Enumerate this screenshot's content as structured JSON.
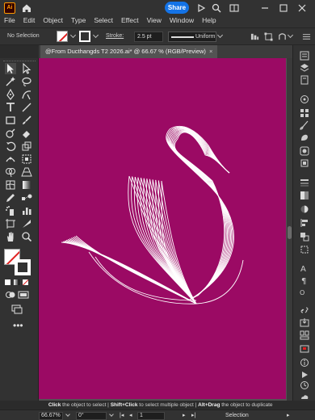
{
  "app": {
    "logo_text": "Ai"
  },
  "menu": [
    "File",
    "Edit",
    "Object",
    "Type",
    "Select",
    "Effect",
    "View",
    "Window",
    "Help"
  ],
  "share_label": "Share",
  "control": {
    "selection_status": "No Selection",
    "stroke_label": "Stroke:",
    "stroke_weight": "2.5 pt",
    "profile": "Uniform"
  },
  "document": {
    "tab_title": "@From Ducthangds T2 2026.ai* @ 66.67 % (RGB/Preview)",
    "close_glyph": "×"
  },
  "canvas": {
    "artboard_color": "#9b0a64",
    "art_stroke_color": "#ffffff"
  },
  "hint": {
    "k1": "Click",
    "t1": "the object to select",
    "k2": "Shift+Click",
    "t2": "to select multiple object",
    "k3": "Alt+Drag",
    "t3": "the object to duplicate"
  },
  "status": {
    "zoom": "66.67%",
    "rotation": "0°",
    "artboard_number": "1",
    "tool_name": "Selection"
  },
  "colors": {
    "accent": "#1473e6",
    "logo": "#ff9a00"
  },
  "icons": {
    "left_tools": [
      "selection-tool-icon",
      "direct-selection-tool-icon",
      "magic-wand-icon",
      "lasso-icon",
      "pen-tool-icon",
      "curvature-tool-icon",
      "type-tool-icon",
      "line-tool-icon",
      "rectangle-tool-icon",
      "paintbrush-icon",
      "shaper-tool-icon",
      "eraser-icon",
      "rotate-tool-icon",
      "scale-tool-icon",
      "width-tool-icon",
      "free-transform-icon",
      "shape-builder-icon",
      "perspective-grid-icon",
      "mesh-tool-icon",
      "gradient-tool-icon",
      "eyedropper-icon",
      "blend-tool-icon",
      "symbol-sprayer-icon",
      "graph-tool-icon",
      "artboard-tool-icon",
      "slice-tool-icon",
      "hand-tool-icon",
      "zoom-tool-icon",
      "edit-toolbar-icon"
    ],
    "right_panels": [
      "properties-icon",
      "layers-icon",
      "libraries-icon",
      "color-icon",
      "swatches-icon",
      "brushes-icon",
      "symbols-icon",
      "graphic-styles-icon",
      "appearance-icon",
      "stroke-icon",
      "gradient-icon",
      "transparency-icon",
      "align-icon",
      "pathfinder-icon",
      "transform-icon",
      "character-icon",
      "paragraph-icon",
      "opentype-icon",
      "links-icon",
      "asset-export-icon",
      "artboards-icon",
      "navigator-icon",
      "info-icon",
      "actions-icon",
      "history-icon",
      "cc-libraries-icon"
    ]
  }
}
